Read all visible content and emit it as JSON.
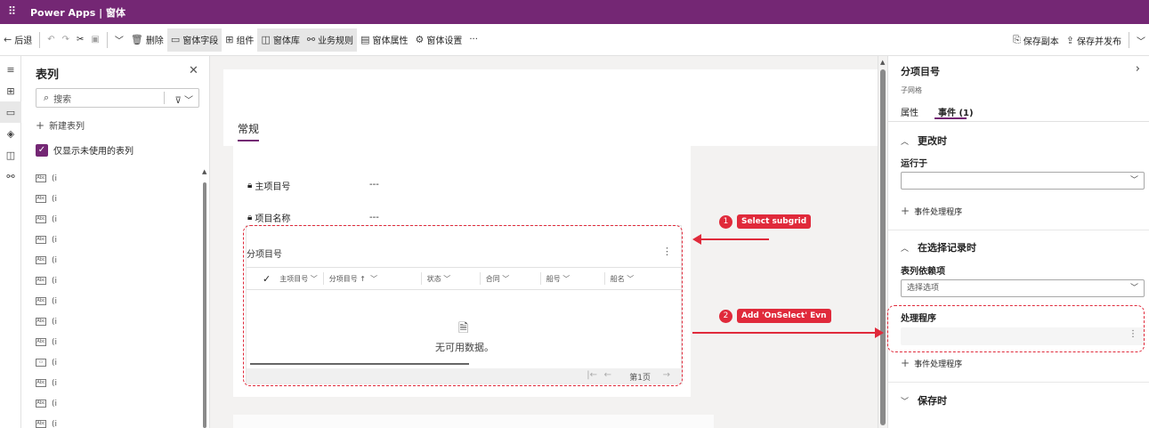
{
  "titlebar": {
    "app_name": "Power Apps | 窗体"
  },
  "commandbar": {
    "back": "后退",
    "delete": "删除",
    "form_fields": "窗体字段",
    "components": "组件",
    "form_library": "窗体库",
    "business_rules": "业务规则",
    "form_properties": "窗体属性",
    "form_settings": "窗体设置",
    "more": "···",
    "save_copy": "保存副本",
    "save_publish": "保存并发布"
  },
  "tables_panel": {
    "title": "表列",
    "search_placeholder": "搜索",
    "new_column": "新建表列",
    "only_unused": "仅显示未使用的表列",
    "items": [
      "(i",
      "(i",
      "(i",
      "(i",
      "(i",
      "(i",
      "(i",
      "(i",
      "(i",
      "(i",
      "(i",
      "(i",
      "(i"
    ]
  },
  "form": {
    "tab_general": "常规",
    "fields": [
      {
        "label": "主项目号",
        "value": "---"
      },
      {
        "label": "项目名称",
        "value": "---"
      }
    ],
    "subgrid": {
      "title": "分项目号",
      "columns": [
        "主项目号",
        "分项目号 ↑",
        "状态",
        "合同",
        "船号",
        "船名"
      ],
      "empty_text": "无可用数据。",
      "page": "第1页"
    }
  },
  "callouts": [
    {
      "number": "1",
      "label": "Select subgrid"
    },
    {
      "number": "2",
      "label": "Add 'OnSelect' Evn"
    }
  ],
  "properties_panel": {
    "title": "分项目号",
    "subtitle": "子网格",
    "tabs": {
      "properties": "属性",
      "events": "事件 (1)"
    },
    "on_change": {
      "header": "更改时",
      "run_on_label": "运行于",
      "run_on_value": "",
      "add_handler": "事件处理程序"
    },
    "on_record_select": {
      "header": "在选择记录时",
      "dependency_label": "表列依赖项",
      "dependency_placeholder": "选择选项",
      "handler_label": "处理程序",
      "add_handler": "事件处理程序"
    },
    "on_save": {
      "header": "保存时"
    }
  },
  "colors": {
    "brand": "#742774",
    "annotation": "#e02a3b"
  }
}
